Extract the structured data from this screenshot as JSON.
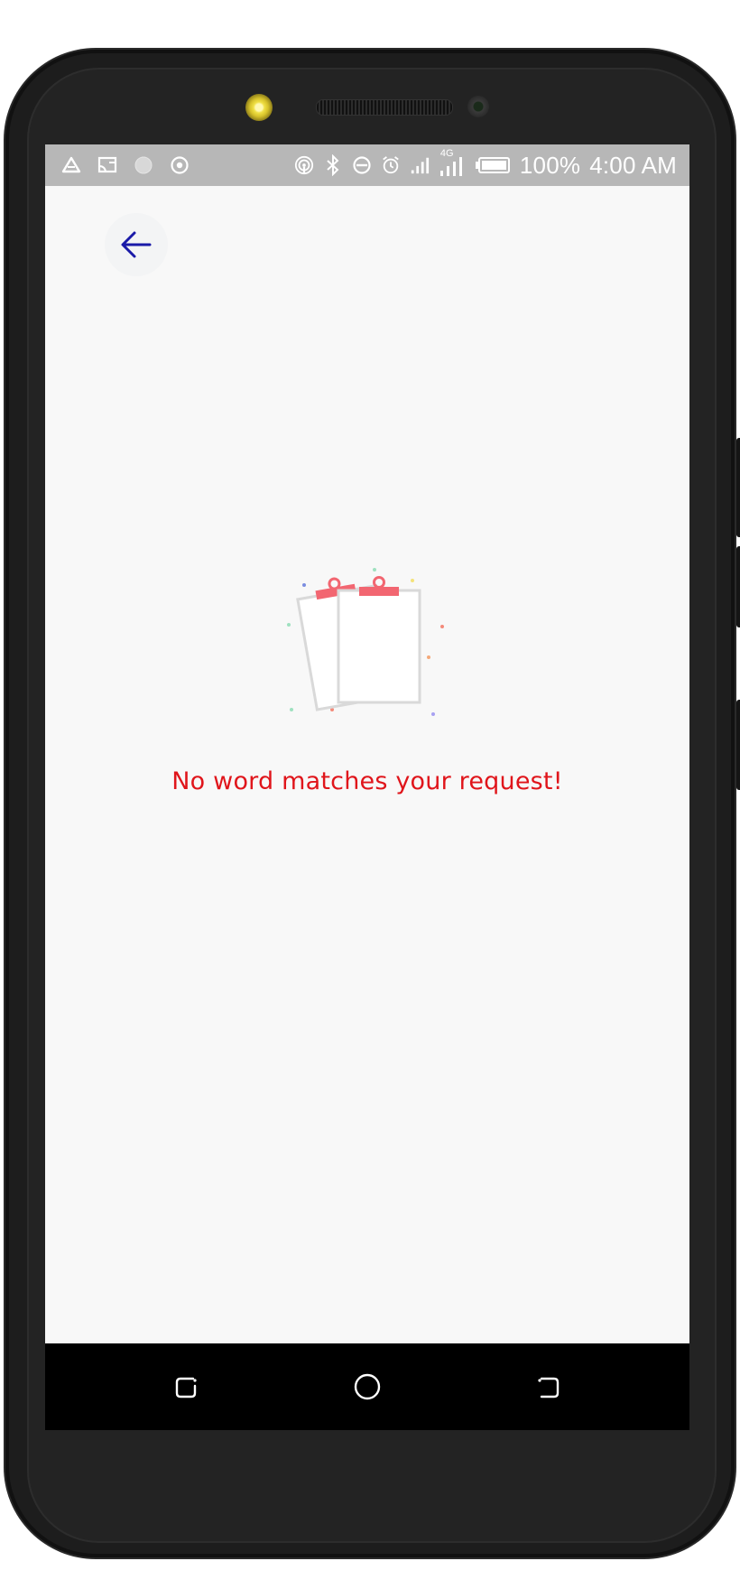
{
  "status_bar": {
    "battery": "100%",
    "time": "4:00 AM",
    "network": "4G",
    "icons_left": [
      "drive-icon",
      "cast-icon",
      "circle-icon",
      "location-icon"
    ],
    "icons_right": [
      "hotspot-icon",
      "bluetooth-icon",
      "dnd-icon",
      "alarm-icon",
      "signal-icon",
      "signal-4g-icon",
      "battery-icon"
    ]
  },
  "header": {
    "back_icon": "arrow-left-icon"
  },
  "empty_state": {
    "message": "No word matches your request!",
    "illustration": "empty-clipboards-illustration"
  },
  "nav_bar": {
    "icons": [
      "recent-apps-icon",
      "home-icon",
      "back-icon"
    ]
  },
  "colors": {
    "accent": "#1a1aa8",
    "message": "#e0151b",
    "clip": "#f26671",
    "status_bar": "#b7b7b7",
    "screen_bg": "#f8f8f8"
  }
}
